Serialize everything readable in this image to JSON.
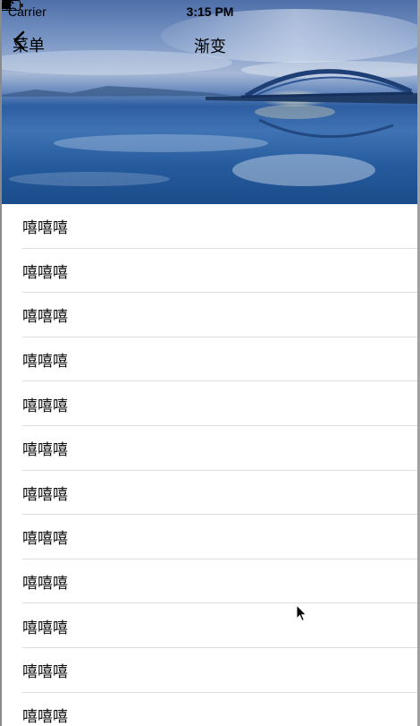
{
  "status_bar": {
    "carrier": "Carrier",
    "time": "3:15 PM"
  },
  "nav": {
    "back_label": "菜单",
    "title": "渐变"
  },
  "list": {
    "items": [
      {
        "label": "嘻嘻嘻"
      },
      {
        "label": "嘻嘻嘻"
      },
      {
        "label": "嘻嘻嘻"
      },
      {
        "label": "嘻嘻嘻"
      },
      {
        "label": "嘻嘻嘻"
      },
      {
        "label": "嘻嘻嘻"
      },
      {
        "label": "嘻嘻嘻"
      },
      {
        "label": "嘻嘻嘻"
      },
      {
        "label": "嘻嘻嘻"
      },
      {
        "label": "嘻嘻嘻"
      },
      {
        "label": "嘻嘻嘻"
      },
      {
        "label": "嘻嘻嘻"
      }
    ]
  },
  "icons": [
    "wifi-icon",
    "battery-icon",
    "chevron-left-icon",
    "cursor-icon"
  ],
  "colors": {
    "sky": "#6d8ec0",
    "water": "#245a9c",
    "separator": "#dedede"
  }
}
